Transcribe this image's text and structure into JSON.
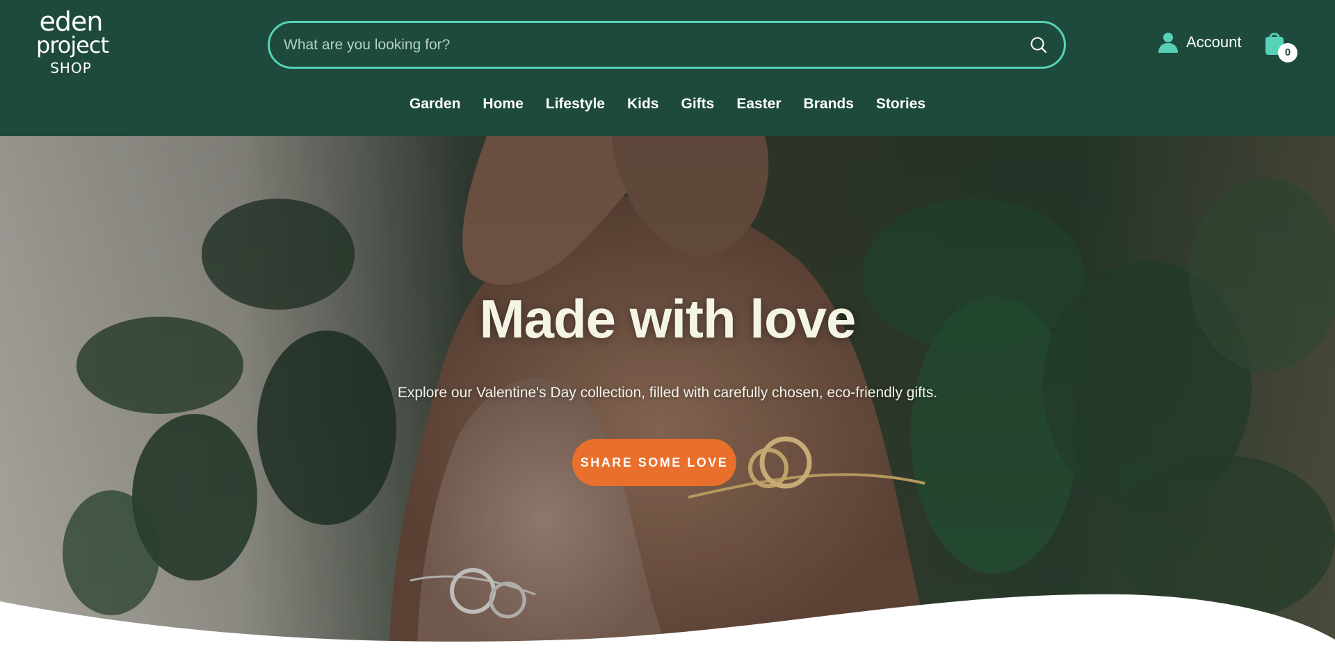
{
  "header": {
    "logo": {
      "line1": "eden",
      "line2": "project",
      "line3": "SHOP"
    },
    "search": {
      "placeholder": "What are you looking for?",
      "value": "",
      "icon": "search-icon"
    },
    "account": {
      "label": "Account",
      "icon": "user-icon"
    },
    "cart": {
      "count": "0",
      "icon": "shopping-bag-icon"
    },
    "nav": [
      "Garden",
      "Home",
      "Lifestyle",
      "Kids",
      "Gifts",
      "Easter",
      "Brands",
      "Stories"
    ]
  },
  "hero": {
    "title": "Made with love",
    "subtitle": "Explore our Valentine's Day collection, filled with carefully chosen, eco-friendly gifts.",
    "cta": "SHARE SOME LOVE"
  },
  "colors": {
    "header_bg": "#1d4a3c",
    "accent_teal": "#58d2b6",
    "cta_orange": "#e86f2c",
    "title_cream": "#f5f5e6"
  }
}
